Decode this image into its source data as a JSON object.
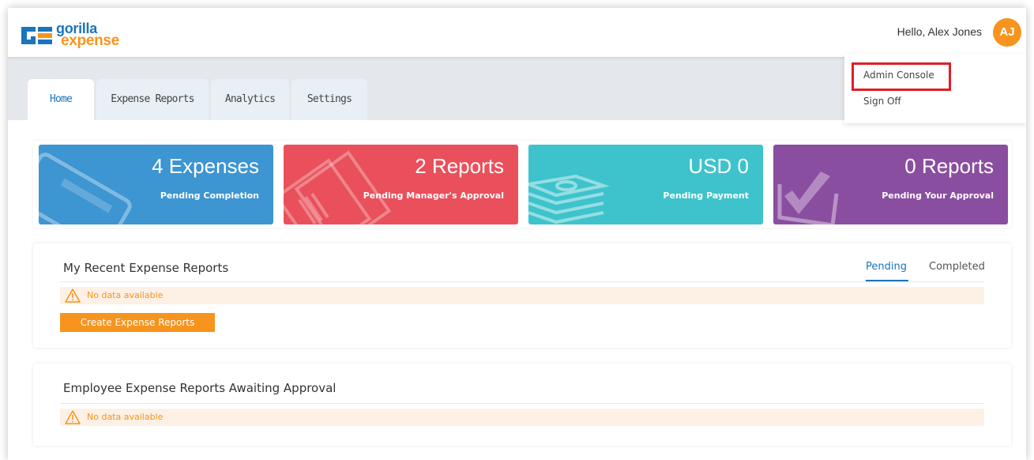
{
  "header": {
    "logo_text_top": "gorilla",
    "logo_text_bottom": "expense",
    "greeting": "Hello, Alex Jones",
    "avatar_initials": "AJ"
  },
  "user_menu": {
    "items": [
      {
        "label": "Admin Console"
      },
      {
        "label": "Sign Off"
      }
    ],
    "highlight_color": "#e01e26"
  },
  "tabs": [
    {
      "label": "Home",
      "active": true
    },
    {
      "label": "Expense Reports",
      "active": false
    },
    {
      "label": "Analytics",
      "active": false
    },
    {
      "label": "Settings",
      "active": false
    }
  ],
  "summary_cards": [
    {
      "value": "4 Expenses",
      "caption": "Pending Completion",
      "color": "#3d95d1",
      "icon": "credit-card-icon"
    },
    {
      "value": "2 Reports",
      "caption": "Pending Manager's Approval",
      "color": "#e9505b",
      "icon": "receipt-icon"
    },
    {
      "value": "USD 0",
      "caption": "Pending Payment",
      "color": "#3ec3cc",
      "icon": "cash-stack-icon"
    },
    {
      "value": "0 Reports",
      "caption": "Pending Your Approval",
      "color": "#8a4ea0",
      "icon": "checkmark-icon"
    }
  ],
  "recent_reports": {
    "title": "My Recent Expense Reports",
    "tabs": [
      {
        "label": "Pending",
        "active": true
      },
      {
        "label": "Completed",
        "active": false
      }
    ],
    "empty_message": "No data available",
    "create_button": "Create Expense Reports"
  },
  "awaiting_approval": {
    "title": "Employee Expense Reports Awaiting Approval",
    "empty_message": "No data available"
  },
  "colors": {
    "brand_blue": "#1b75bb",
    "brand_orange": "#f7941d"
  }
}
